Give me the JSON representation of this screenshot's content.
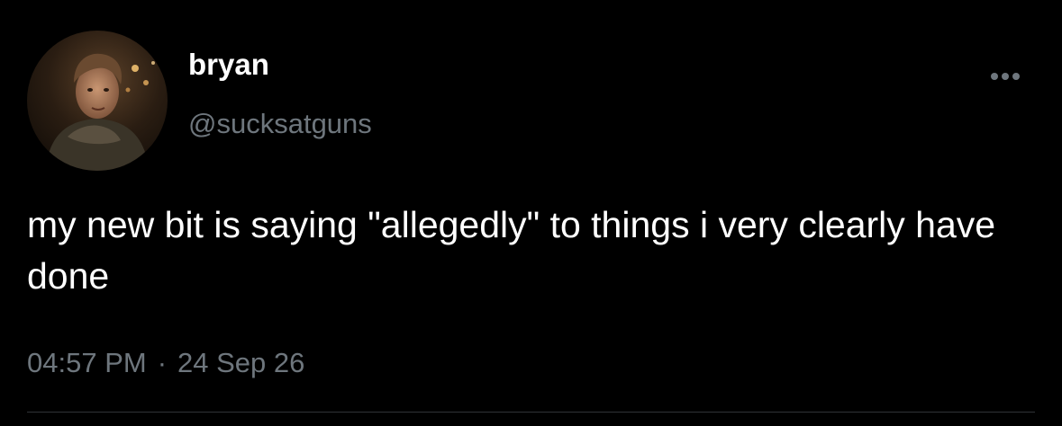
{
  "user": {
    "display_name": "bryan",
    "handle": "@sucksatguns"
  },
  "tweet": {
    "text": "my new bit is saying \"allegedly\" to things i very clearly have done",
    "time": "04:57 PM",
    "separator": "·",
    "date": "24 Sep 26"
  },
  "icons": {
    "avatar": "profile-photo",
    "more": "more-horizontal-icon"
  },
  "colors": {
    "background": "#000000",
    "primary_text": "#ffffff",
    "secondary_text": "#6e767d",
    "divider": "#2f3336"
  }
}
